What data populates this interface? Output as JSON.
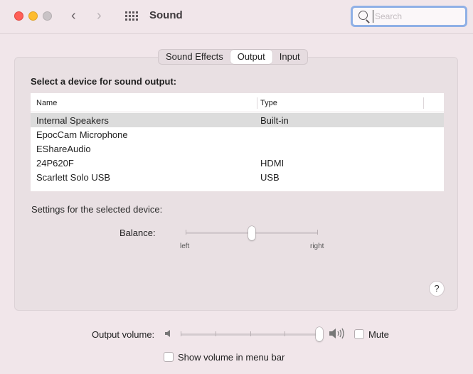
{
  "window": {
    "title": "Sound",
    "search_placeholder": "Search"
  },
  "tabs": [
    {
      "label": "Sound Effects",
      "selected": false
    },
    {
      "label": "Output",
      "selected": true
    },
    {
      "label": "Input",
      "selected": false
    }
  ],
  "output": {
    "heading": "Select a device for sound output:",
    "columns": {
      "name": "Name",
      "type": "Type"
    },
    "devices": [
      {
        "name": "Internal Speakers",
        "type": "Built-in",
        "selected": true
      },
      {
        "name": "EpocCam Microphone",
        "type": ""
      },
      {
        "name": "EShareAudio",
        "type": ""
      },
      {
        "name": "24P620F",
        "type": "HDMI"
      },
      {
        "name": "Scarlett Solo USB",
        "type": "USB"
      }
    ],
    "settings_label": "Settings for the selected device:",
    "balance": {
      "label": "Balance:",
      "left": "left",
      "right": "right",
      "value": 0.5
    },
    "help": "?"
  },
  "footer": {
    "volume_label": "Output volume:",
    "volume_value": 1.0,
    "mute_label": "Mute",
    "mute_checked": false,
    "menu_bar_label": "Show volume in menu bar",
    "menu_bar_checked": false
  }
}
